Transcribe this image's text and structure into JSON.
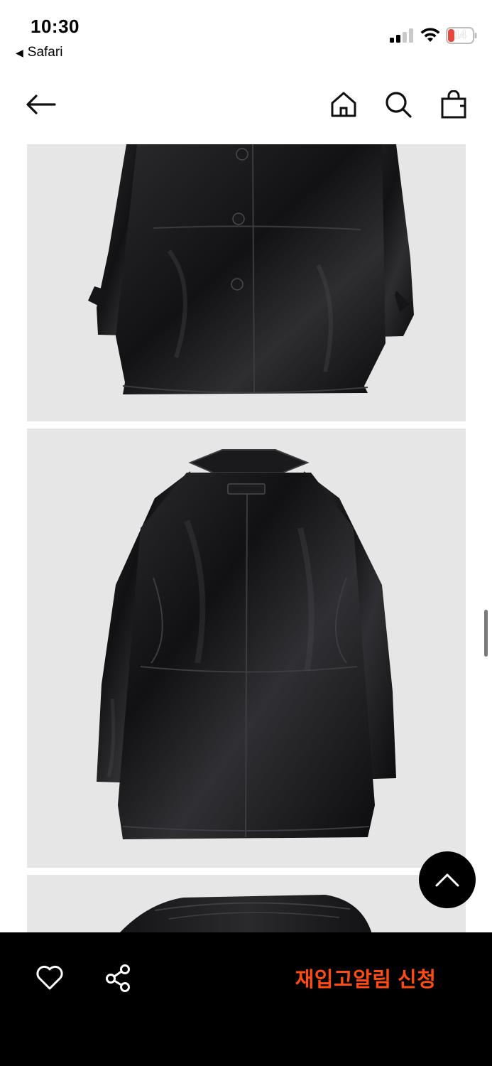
{
  "status_bar": {
    "time": "10:30",
    "back_app_label": "Safari",
    "battery_level": "14",
    "battery_color": "#e5483f"
  },
  "header": {
    "back_icon": "arrow-left-icon",
    "home_icon": "home-icon",
    "search_icon": "search-icon",
    "bag_icon": "shopping-bag-icon"
  },
  "gallery": {
    "images": [
      {
        "view": "front",
        "alt": ""
      },
      {
        "view": "back",
        "alt": ""
      },
      {
        "view": "collar-detail",
        "alt": ""
      }
    ],
    "background_color": "#e6e6e6"
  },
  "floating": {
    "scroll_top_icon": "chevron-up-icon"
  },
  "bottom_bar": {
    "wishlist_icon": "heart-icon",
    "share_icon": "share-icon",
    "restock_label": "재입고알림 신청",
    "accent_color": "#ff4b12"
  }
}
